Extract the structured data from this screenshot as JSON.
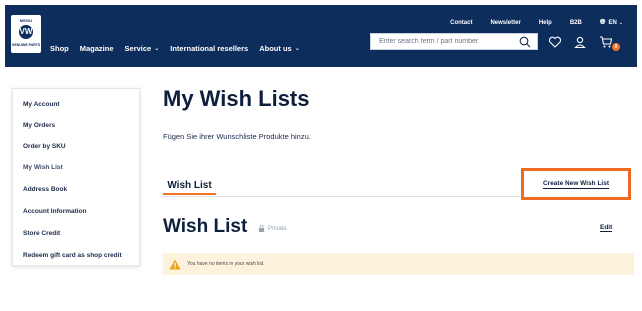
{
  "header": {
    "logo": {
      "top_text": "MENU",
      "badge_text": "VW",
      "bottom_text": "GENUINE PARTS"
    },
    "nav": [
      {
        "label": "Shop",
        "has_caret": false
      },
      {
        "label": "Magazine",
        "has_caret": false
      },
      {
        "label": "Service",
        "has_caret": true
      },
      {
        "label": "International resellers",
        "has_caret": false
      },
      {
        "label": "About us",
        "has_caret": true
      }
    ],
    "top_links": {
      "contact": "Contact",
      "newsletter": "Newsletter",
      "help": "Help",
      "b2b": "B2B",
      "language": "EN"
    },
    "search": {
      "placeholder": "Enter search term / part number"
    },
    "cart_count": "0"
  },
  "sidebar": {
    "items": [
      {
        "label": "My Account"
      },
      {
        "label": "My Orders"
      },
      {
        "label": "Order by SKU"
      },
      {
        "label": "My Wish List",
        "active": true
      },
      {
        "label": "Address Book"
      },
      {
        "label": "Account Information"
      },
      {
        "label": "Store Credit"
      },
      {
        "label": "Redeem gift card as shop credit"
      }
    ]
  },
  "main": {
    "title": "My Wish Lists",
    "subtitle": "Fügen Sie ihrer Wunschliste Produkte hinzu.",
    "tab_label": "Wish List",
    "create_button": "Create New Wish List",
    "wishlist": {
      "title": "Wish List",
      "privacy": "Private",
      "edit_label": "Edit",
      "empty_message": "You have no items in your wish list."
    }
  },
  "colors": {
    "header_bg": "#0d2d5c",
    "accent": "#f07321",
    "highlight_border": "#ee6b23",
    "alert_bg": "#fdf3dc",
    "warning": "#e8a317"
  },
  "icons": [
    "search-icon",
    "heart-icon",
    "user-icon",
    "cart-icon",
    "globe-icon",
    "lock-icon",
    "warning-icon"
  ]
}
